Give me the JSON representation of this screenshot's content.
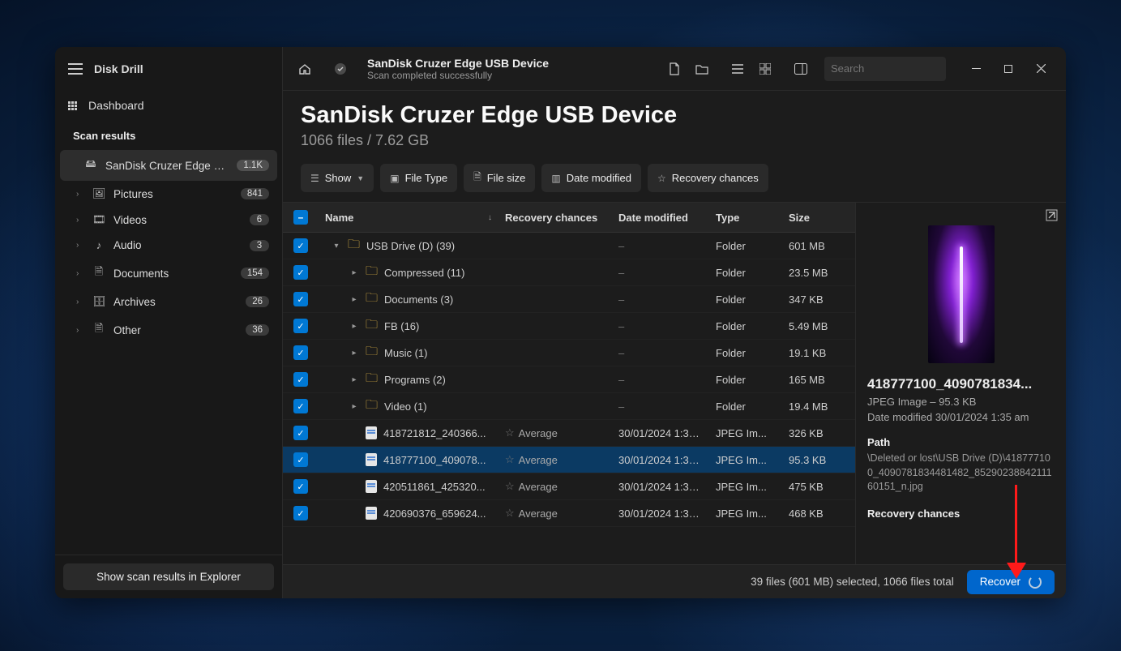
{
  "app_name": "Disk Drill",
  "dashboard_label": "Dashboard",
  "section_label": "Scan results",
  "sidebar_items": [
    {
      "label": "SanDisk Cruzer Edge US...",
      "count": "1.1K",
      "icon": "usb",
      "active": true,
      "child": false
    },
    {
      "label": "Pictures",
      "count": "841",
      "icon": "image",
      "active": false,
      "child": true
    },
    {
      "label": "Videos",
      "count": "6",
      "icon": "video",
      "active": false,
      "child": true
    },
    {
      "label": "Audio",
      "count": "3",
      "icon": "audio",
      "active": false,
      "child": true
    },
    {
      "label": "Documents",
      "count": "154",
      "icon": "doc",
      "active": false,
      "child": true
    },
    {
      "label": "Archives",
      "count": "26",
      "icon": "archive",
      "active": false,
      "child": true
    },
    {
      "label": "Other",
      "count": "36",
      "icon": "other",
      "active": false,
      "child": true
    }
  ],
  "explorer_button": "Show scan results in Explorer",
  "device": {
    "title": "SanDisk Cruzer Edge USB Device",
    "status": "Scan completed successfully"
  },
  "search_placeholder": "Search",
  "header": {
    "title": "SanDisk Cruzer Edge USB Device",
    "sub": "1066 files / 7.62 GB"
  },
  "toolbar": {
    "show": "Show",
    "file_type": "File Type",
    "file_size": "File size",
    "date_modified": "Date modified",
    "recovery_chances": "Recovery chances"
  },
  "columns": {
    "name": "Name",
    "recovery": "Recovery chances",
    "date": "Date modified",
    "type": "Type",
    "size": "Size"
  },
  "rows": [
    {
      "indent": 0,
      "expander": "▾",
      "icon": "folder",
      "name": "USB Drive (D) (39)",
      "recovery": "",
      "date": "–",
      "type": "Folder",
      "size": "601 MB",
      "selected": false
    },
    {
      "indent": 1,
      "expander": "▸",
      "icon": "folder",
      "name": "Compressed (11)",
      "recovery": "",
      "date": "–",
      "type": "Folder",
      "size": "23.5 MB",
      "selected": false
    },
    {
      "indent": 1,
      "expander": "▸",
      "icon": "folder",
      "name": "Documents (3)",
      "recovery": "",
      "date": "–",
      "type": "Folder",
      "size": "347 KB",
      "selected": false
    },
    {
      "indent": 1,
      "expander": "▸",
      "icon": "folder",
      "name": "FB (16)",
      "recovery": "",
      "date": "–",
      "type": "Folder",
      "size": "5.49 MB",
      "selected": false
    },
    {
      "indent": 1,
      "expander": "▸",
      "icon": "folder",
      "name": "Music (1)",
      "recovery": "",
      "date": "–",
      "type": "Folder",
      "size": "19.1 KB",
      "selected": false
    },
    {
      "indent": 1,
      "expander": "▸",
      "icon": "folder",
      "name": "Programs (2)",
      "recovery": "",
      "date": "–",
      "type": "Folder",
      "size": "165 MB",
      "selected": false
    },
    {
      "indent": 1,
      "expander": "▸",
      "icon": "folder",
      "name": "Video (1)",
      "recovery": "",
      "date": "–",
      "type": "Folder",
      "size": "19.4 MB",
      "selected": false
    },
    {
      "indent": 1,
      "expander": "",
      "icon": "file",
      "name": "418721812_240366...",
      "recovery": "Average",
      "date": "30/01/2024 1:36...",
      "type": "JPEG Im...",
      "size": "326 KB",
      "selected": false
    },
    {
      "indent": 1,
      "expander": "",
      "icon": "file",
      "name": "418777100_409078...",
      "recovery": "Average",
      "date": "30/01/2024 1:35...",
      "type": "JPEG Im...",
      "size": "95.3 KB",
      "selected": true
    },
    {
      "indent": 1,
      "expander": "",
      "icon": "file",
      "name": "420511861_425320...",
      "recovery": "Average",
      "date": "30/01/2024 1:36...",
      "type": "JPEG Im...",
      "size": "475 KB",
      "selected": false
    },
    {
      "indent": 1,
      "expander": "",
      "icon": "file",
      "name": "420690376_659624...",
      "recovery": "Average",
      "date": "30/01/2024 1:36...",
      "type": "JPEG Im...",
      "size": "468 KB",
      "selected": false
    }
  ],
  "preview": {
    "title": "418777100_4090781834...",
    "type_line": "JPEG Image – 95.3 KB",
    "date_line": "Date modified 30/01/2024 1:35 am",
    "path_label": "Path",
    "path_value": "\\Deleted or lost\\USB Drive (D)\\418777100_4090781834481482_8529023884211160151_n.jpg",
    "chances_label": "Recovery chances"
  },
  "statusbar": {
    "summary": "39 files (601 MB) selected, 1066 files total",
    "recover": "Recover"
  }
}
